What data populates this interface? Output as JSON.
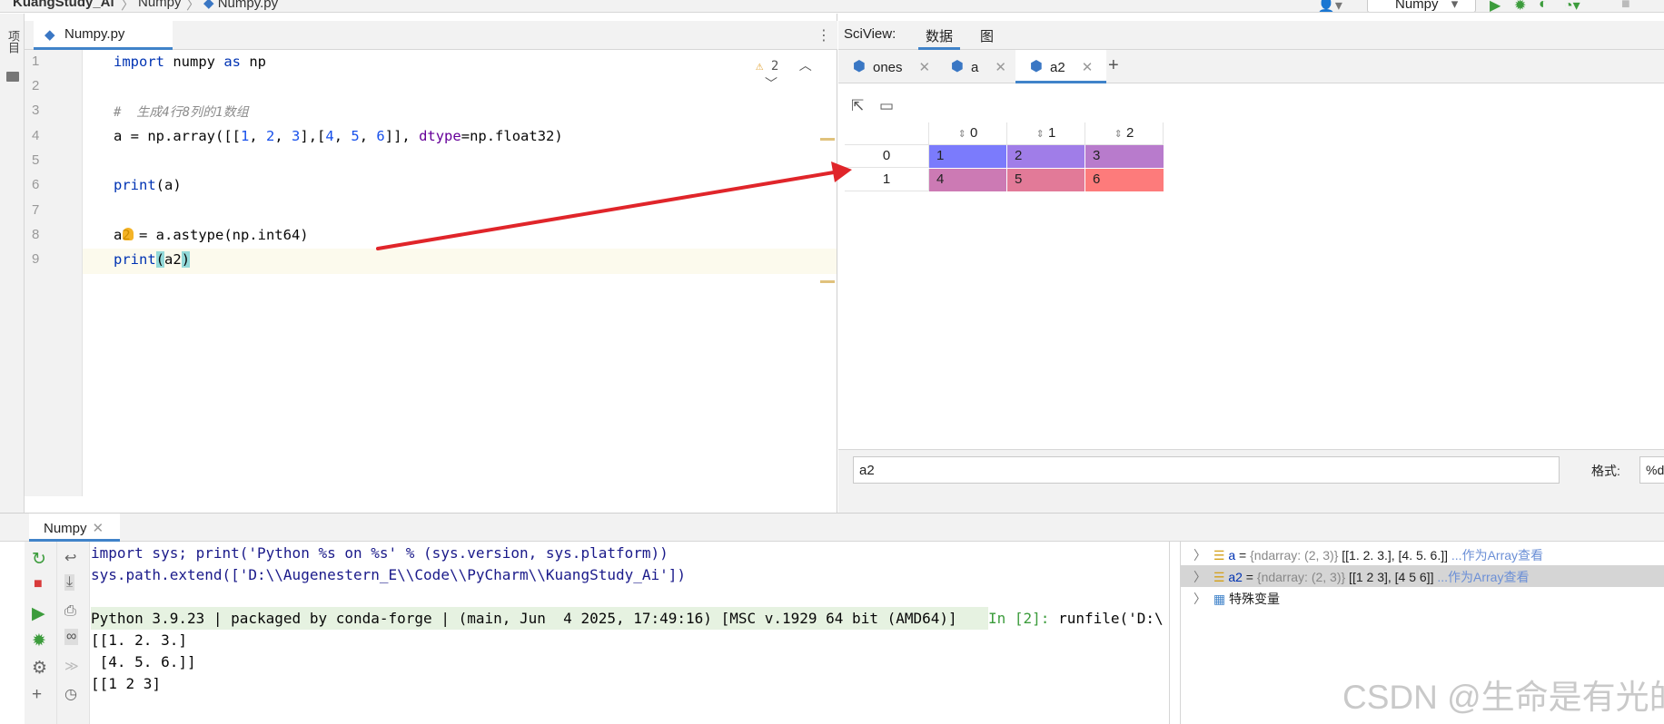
{
  "breadcrumb": {
    "project": "KuangStudy_Ai",
    "folder": "Numpy",
    "file": "Numpy.py"
  },
  "run_config": "Numpy",
  "left_strip": {
    "project_label": "项目"
  },
  "editor": {
    "tab": "Numpy.py",
    "warnings": "2",
    "lines": [
      {
        "n": "1"
      },
      {
        "n": "2"
      },
      {
        "n": "3"
      },
      {
        "n": "4"
      },
      {
        "n": "5"
      },
      {
        "n": "6"
      },
      {
        "n": "7"
      },
      {
        "n": "8"
      },
      {
        "n": "9"
      }
    ],
    "code": {
      "l1_kw1": "import",
      "l1_mod": " numpy ",
      "l1_kw2": "as",
      "l1_alias": " np",
      "l3_comment": "#  生成4行8列的1数组",
      "l4_a": "a = np.array([[",
      "l4_n1": "1",
      "l4_c1": ", ",
      "l4_n2": "2",
      "l4_c2": ", ",
      "l4_n3": "3",
      "l4_b": "],[",
      "l4_n4": "4",
      "l4_c3": ", ",
      "l4_n5": "5",
      "l4_c4": ", ",
      "l4_n6": "6",
      "l4_e": "]], ",
      "l4_param": "dtype",
      "l4_tail": "=np.float32)",
      "l6_kw": "print",
      "l6_rest": "(a)",
      "l8_a": "a2 = a.astype(np.int64)",
      "l9_kw": "print",
      "l9_p1": "(",
      "l9_arg": "a2",
      "l9_p2": ")"
    }
  },
  "sciview": {
    "label": "SciView:",
    "tab_data": "数据",
    "tab_plots": "图",
    "tabs": [
      {
        "label": "ones"
      },
      {
        "label": "a"
      },
      {
        "label": "a2"
      }
    ],
    "columns": [
      "0",
      "1",
      "2"
    ],
    "rows": [
      {
        "index": "0",
        "cells": [
          "1",
          "2",
          "3"
        ]
      },
      {
        "index": "1",
        "cells": [
          "4",
          "5",
          "6"
        ]
      }
    ],
    "cell_colors": [
      [
        "#7b7bfc",
        "#a07de8",
        "#b87bcc"
      ],
      [
        "#cc7ab4",
        "#e27a98",
        "#fd7b7b"
      ]
    ],
    "expression": "a2",
    "format_label": "格式:",
    "format_value": "%d"
  },
  "console": {
    "tab": "Numpy",
    "lines": [
      "import sys; print('Python %s on %s' % (sys.version, sys.platform))",
      "sys.path.extend(['D:\\\\Augenestern_E\\\\Code\\\\PyCharm\\\\KuangStudy_Ai'])",
      "",
      "Python 3.9.23 | packaged by conda-forge | (main, Jun  4 2025, 17:49:16) [MSC v.1929 64 bit (AMD64)]",
      "[[1. 2. 3.]",
      " [4. 5. 6.]]",
      "[[1 2 3]"
    ],
    "prompt": "In [2]: ",
    "prompt_cmd": "runfile('D:\\"
  },
  "variables": [
    {
      "name": "a",
      "eq": " = ",
      "type": "{ndarray: (2, 3)}",
      "value": " [[1. 2. 3.], [4. 5. 6.]] ",
      "link": "...作为Array查看"
    },
    {
      "name": "a2",
      "eq": " = ",
      "type": "{ndarray: (2, 3)}",
      "value": " [[1 2 3], [4 5 6]] ",
      "link": "...作为Array查看"
    },
    {
      "name": "特殊变量"
    }
  ],
  "watermark": "CSDN @生命是有光的",
  "colors": {
    "accent": "#4083c9",
    "arrow": "#e0252a"
  }
}
